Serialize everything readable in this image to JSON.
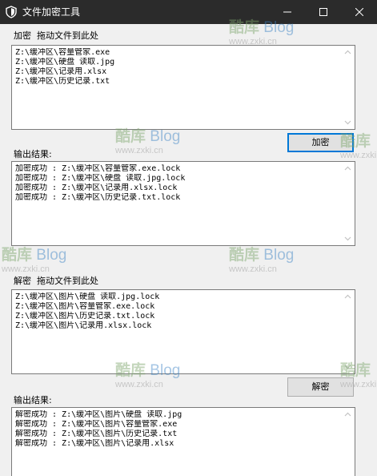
{
  "window": {
    "title": "文件加密工具",
    "icon": "shield-icon",
    "controls": [
      "minimize-icon",
      "maximize-icon",
      "close-icon"
    ]
  },
  "encrypt": {
    "label": "加密  拖动文件到此处",
    "files": [
      "Z:\\缓冲区\\容量管家.exe",
      "Z:\\缓冲区\\硬盘 读取.jpg",
      "Z:\\缓冲区\\记录用.xlsx",
      "Z:\\缓冲区\\历史记录.txt"
    ],
    "button_label": "加密",
    "output_label": "输出结果:",
    "output": [
      "加密成功 : Z:\\缓冲区\\容量管家.exe.lock",
      "加密成功 : Z:\\缓冲区\\硬盘 读取.jpg.lock",
      "加密成功 : Z:\\缓冲区\\记录用.xlsx.lock",
      "加密成功 : Z:\\缓冲区\\历史记录.txt.lock"
    ]
  },
  "decrypt": {
    "label": "解密  拖动文件到此处",
    "files": [
      "Z:\\缓冲区\\图片\\硬盘 读取.jpg.lock",
      "Z:\\缓冲区\\图片\\容量管家.exe.lock",
      "Z:\\缓冲区\\图片\\历史记录.txt.lock",
      "Z:\\缓冲区\\图片\\记录用.xlsx.lock"
    ],
    "button_label": "解密",
    "output_label": "输出结果:",
    "output": [
      "解密成功 : Z:\\缓冲区\\图片\\硬盘 读取.jpg",
      "解密成功 : Z:\\缓冲区\\图片\\容量管家.exe",
      "解密成功 : Z:\\缓冲区\\图片\\历史记录.txt",
      "解密成功 : Z:\\缓冲区\\图片\\记录用.xlsx"
    ]
  },
  "watermark": {
    "cn": "酷库",
    "latin": "Blog",
    "url": "www.zxki.cn"
  },
  "colors": {
    "titlebar": "#2b2b2b",
    "focus_border": "#0078d7"
  }
}
